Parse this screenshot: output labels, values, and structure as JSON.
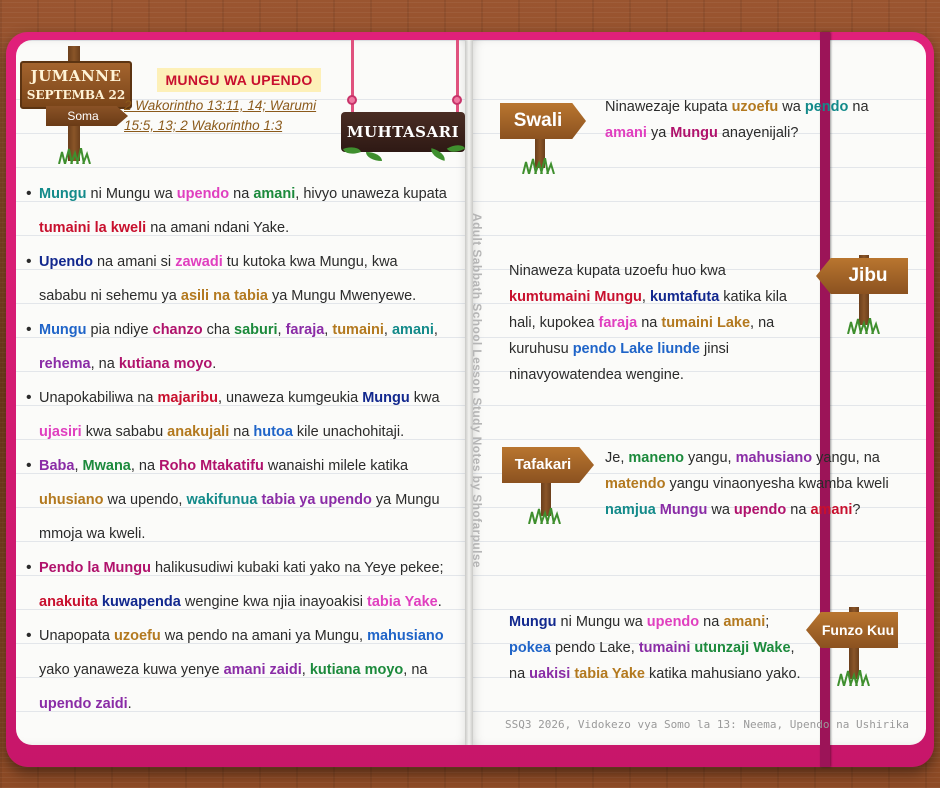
{
  "header": {
    "day": "JUMANNE",
    "date": "SEPTEMBA 22",
    "soma_label": "Soma",
    "lesson_title": "MUNGU WA UPENDO",
    "scripture": "2 Wakorintho 13:11, 14; Warumi 15:5, 13; 2 Wakorintho 1:3",
    "summary_label": "MUHTASARI"
  },
  "vertical_note": "Adult Sabbath School Lesson Study Notes by Shofarpulse",
  "bullets": [
    [
      {
        "t": "Mungu",
        "c": "teal"
      },
      {
        "t": " ni Mungu wa "
      },
      {
        "t": "upendo",
        "c": "pink"
      },
      {
        "t": " na "
      },
      {
        "t": "amani",
        "c": "green"
      },
      {
        "t": ", hivyo unaweza kupata "
      },
      {
        "t": "tumaini la kweli",
        "c": "red"
      },
      {
        "t": " na amani ndani Yake."
      }
    ],
    [
      {
        "t": "Upendo",
        "c": "navy"
      },
      {
        "t": " na amani si "
      },
      {
        "t": "zawadi",
        "c": "pink"
      },
      {
        "t": " tu kutoka kwa Mungu, kwa sababu ni sehemu ya "
      },
      {
        "t": "asili na tabia",
        "c": "brown"
      },
      {
        "t": " ya Mungu Mwenyewe."
      }
    ],
    [
      {
        "t": "Mungu",
        "c": "blue"
      },
      {
        "t": " pia ndiye "
      },
      {
        "t": "chanzo",
        "c": "magenta"
      },
      {
        "t": " cha "
      },
      {
        "t": "saburi",
        "c": "green"
      },
      {
        "t": ", "
      },
      {
        "t": "faraja",
        "c": "purple"
      },
      {
        "t": ", "
      },
      {
        "t": "tumaini",
        "c": "brown"
      },
      {
        "t": ", "
      },
      {
        "t": "amani",
        "c": "teal"
      },
      {
        "t": ", "
      },
      {
        "t": "rehema",
        "c": "purple"
      },
      {
        "t": ", na "
      },
      {
        "t": "kutiana moyo",
        "c": "magenta"
      },
      {
        "t": "."
      }
    ],
    [
      {
        "t": "Unapokabiliwa na "
      },
      {
        "t": "majaribu",
        "c": "red"
      },
      {
        "t": ", unaweza kumgeukia "
      },
      {
        "t": "Mungu",
        "c": "navy"
      },
      {
        "t": " kwa "
      },
      {
        "t": "ujasiri",
        "c": "pink"
      },
      {
        "t": " kwa sababu "
      },
      {
        "t": "anakujali",
        "c": "brown"
      },
      {
        "t": " na "
      },
      {
        "t": "hutoa",
        "c": "blue"
      },
      {
        "t": " kile unachohitaji."
      }
    ],
    [
      {
        "t": "Baba",
        "c": "purple"
      },
      {
        "t": ", "
      },
      {
        "t": "Mwana",
        "c": "green"
      },
      {
        "t": ", na "
      },
      {
        "t": "Roho Mtakatifu",
        "c": "magenta"
      },
      {
        "t": " wanaishi milele katika "
      },
      {
        "t": "uhusiano",
        "c": "brown"
      },
      {
        "t": " wa upendo, "
      },
      {
        "t": "wakifunua",
        "c": "teal"
      },
      {
        "t": " "
      },
      {
        "t": "tabia ya upendo",
        "c": "purple"
      },
      {
        "t": " ya Mungu mmoja wa kweli."
      }
    ],
    [
      {
        "t": "Pendo la Mungu",
        "c": "magenta"
      },
      {
        "t": " halikusudiwi kubaki kati yako na Yeye pekee; "
      },
      {
        "t": "anakuita",
        "c": "red"
      },
      {
        "t": " "
      },
      {
        "t": "kuwapenda",
        "c": "navy"
      },
      {
        "t": " wengine kwa njia inayoakisi "
      },
      {
        "t": "tabia Yake",
        "c": "pink"
      },
      {
        "t": "."
      }
    ],
    [
      {
        "t": "Unapopata "
      },
      {
        "t": "uzoefu",
        "c": "brown"
      },
      {
        "t": " wa pendo na amani ya Mungu, "
      },
      {
        "t": "mahusiano",
        "c": "blue"
      },
      {
        "t": " yako yanaweza kuwa yenye "
      },
      {
        "t": "amani zaidi",
        "c": "purple"
      },
      {
        "t": ", "
      },
      {
        "t": "kutiana moyo",
        "c": "green"
      },
      {
        "t": ", na "
      },
      {
        "t": "upendo zaidi",
        "c": "purple"
      },
      {
        "t": "."
      }
    ]
  ],
  "swali": {
    "label": "Swali",
    "text": [
      {
        "t": "Ninawezaje kupata "
      },
      {
        "t": "uzoefu",
        "c": "brown"
      },
      {
        "t": " wa "
      },
      {
        "t": "pendo",
        "c": "teal"
      },
      {
        "t": " na "
      },
      {
        "t": "amani",
        "c": "pink"
      },
      {
        "t": " ya "
      },
      {
        "t": "Mungu",
        "c": "magenta"
      },
      {
        "t": " anayenijali?"
      }
    ]
  },
  "jibu": {
    "label": "Jibu",
    "text": [
      {
        "t": "Ninaweza kupata uzoefu huo kwa "
      },
      {
        "t": "kumtumaini Mungu",
        "c": "red"
      },
      {
        "t": ", "
      },
      {
        "t": "kumtafuta",
        "c": "navy"
      },
      {
        "t": " katika kila hali, kupokea "
      },
      {
        "t": "faraja",
        "c": "pink"
      },
      {
        "t": " na "
      },
      {
        "t": "tumaini Lake",
        "c": "brown"
      },
      {
        "t": ", na kuruhusu "
      },
      {
        "t": "pendo Lake liunde",
        "c": "blue"
      },
      {
        "t": " jinsi ninavyowatendea wengine."
      }
    ]
  },
  "tafakari": {
    "label": "Tafakari",
    "text": [
      {
        "t": "Je, "
      },
      {
        "t": "maneno",
        "c": "green"
      },
      {
        "t": " yangu, "
      },
      {
        "t": "mahusiano",
        "c": "purple"
      },
      {
        "t": " yangu, na "
      },
      {
        "t": "matendo",
        "c": "brown"
      },
      {
        "t": " yangu vinaonyesha kwamba kweli "
      },
      {
        "t": "namjua",
        "c": "teal"
      },
      {
        "t": " "
      },
      {
        "t": "Mungu",
        "c": "purple"
      },
      {
        "t": " wa "
      },
      {
        "t": "upendo",
        "c": "magenta"
      },
      {
        "t": " na "
      },
      {
        "t": "amani",
        "c": "red"
      },
      {
        "t": "?"
      }
    ]
  },
  "funzo_kuu": {
    "label": "Funzo Kuu",
    "text": [
      {
        "t": "Mungu",
        "c": "navy"
      },
      {
        "t": " ni Mungu wa "
      },
      {
        "t": "upendo",
        "c": "pink"
      },
      {
        "t": " na "
      },
      {
        "t": "amani",
        "c": "brown"
      },
      {
        "t": "; "
      },
      {
        "t": "pokea",
        "c": "blue"
      },
      {
        "t": " pendo Lake, "
      },
      {
        "t": "tumaini",
        "c": "purple"
      },
      {
        "t": " "
      },
      {
        "t": "utunzaji Wake",
        "c": "green"
      },
      {
        "t": ", na "
      },
      {
        "t": "uakisi",
        "c": "purple"
      },
      {
        "t": " "
      },
      {
        "t": "tabia Yake",
        "c": "brown"
      },
      {
        "t": " katika mahusiano yako."
      }
    ]
  },
  "footer": "SSQ3 2026, Vidokezo vya Somo la 13: Neema, Upendo na Ushirika",
  "colors": {
    "teal": "#138a8a",
    "pink": "#e03fbf",
    "green": "#1c8a3c",
    "red": "#c8102e",
    "navy": "#12288e",
    "brown": "#b3791f",
    "purple": "#8a2ca6",
    "blue": "#1f64c8",
    "magenta": "#b0126c",
    "notebook_cover": "#d81b72"
  },
  "icons": [
    "signpost-icon",
    "grass-icon",
    "leaf-icon",
    "rope-icon"
  ]
}
